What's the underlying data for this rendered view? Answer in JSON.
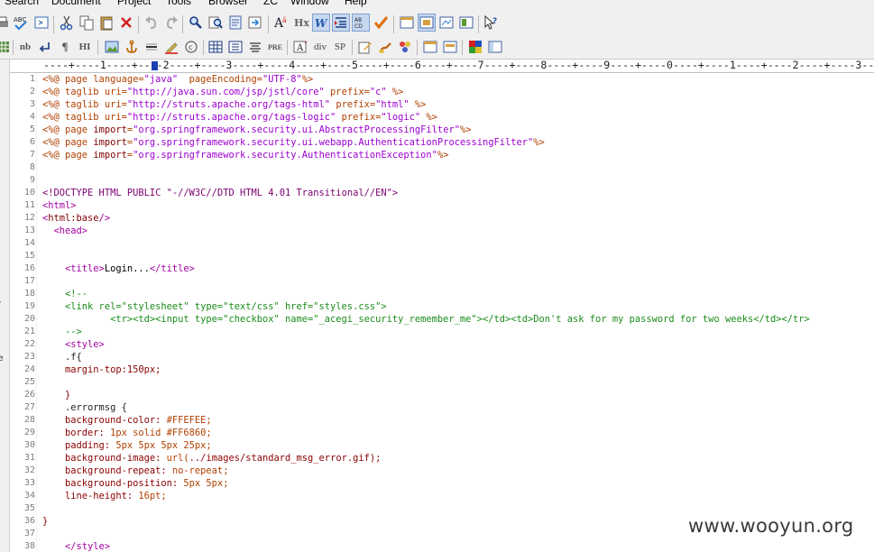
{
  "menu": [
    "Search",
    "Document",
    "Project",
    "Tools",
    "Browser",
    "ZC",
    "Window",
    "Help"
  ],
  "toolbar2": {
    "nb": "nb",
    "pilcrow": "¶",
    "hi": "HI",
    "pre": "PRE",
    "div": "div",
    "sp": "SP"
  },
  "ruler": "----+----1----+----2----+----3----+----4----+----5----+----6----+----7----+----8----+----9----+----0----+----1----+----2----+----3--",
  "line_numbers": [
    "1",
    "2",
    "3",
    "4",
    "5",
    "6",
    "7",
    "8",
    "9",
    "10",
    "11",
    "12",
    "13",
    "14",
    "15",
    "16",
    "17",
    "18",
    "19",
    "20",
    "21",
    "22",
    "23",
    "24",
    "25",
    "26",
    "27",
    "28",
    "29",
    "30",
    "31",
    "32",
    "33",
    "34",
    "35",
    "36",
    "37",
    "38"
  ],
  "code": {
    "l1": {
      "a": "<%@ page language=",
      "b": "\"java\"",
      "c": "  pageEncoding=",
      "d": "\"UTF-8\"",
      "e": "%>"
    },
    "l2": {
      "a": "<%@ taglib uri=",
      "b": "\"http://java.sun.com/jsp/jstl/core\"",
      "c": " prefix=",
      "d": "\"c\"",
      "e": " %>"
    },
    "l3": {
      "a": "<%@ taglib uri=",
      "b": "\"http://struts.apache.org/tags-html\"",
      "c": " prefix=",
      "d": "\"html\"",
      "e": " %>"
    },
    "l4": {
      "a": "<%@ taglib uri=",
      "b": "\"http://struts.apache.org/tags-logic\"",
      "c": " prefix=",
      "d": "\"logic\"",
      "e": " %>"
    },
    "l5": {
      "a": "<%@ page ",
      "b": "import",
      "c": "=",
      "d": "\"org.springframework.security.ui.AbstractProcessingFilter\"",
      "e": "%>"
    },
    "l6": {
      "a": "<%@ page ",
      "b": "import",
      "c": "=",
      "d": "\"org.springframework.security.ui.webapp.AuthenticationProcessingFilter\"",
      "e": "%>"
    },
    "l7": {
      "a": "<%@ page ",
      "b": "import",
      "c": "=",
      "d": "\"org.springframework.security.AuthenticationException\"",
      "e": "%>"
    },
    "l10": {
      "a": "<!DOCTYPE HTML PUBLIC ",
      "b": "\"-//W3C//DTD HTML 4.01 Transitional//EN\"",
      "c": ">"
    },
    "l11": "<html>",
    "l12": {
      "a": "<",
      "b": "html:base",
      "c": "/>"
    },
    "l13": "  <head>",
    "l16": {
      "a": "    <title>",
      "b": "Login...",
      "c": "</title>"
    },
    "l18": "    <!--",
    "l19": "    <link rel=\"stylesheet\" type=\"text/css\" href=\"styles.css\">",
    "l20": "            <tr><td><input type=\"checkbox\" name=\"_acegi_security_remember_me\"></td><td>Don't ask for my password for two weeks</td></tr>",
    "l21": "    -->",
    "l22": "    <style>",
    "l23": "    .f{",
    "l24": {
      "a": "    margin-top:",
      "b": "150px;"
    },
    "l26": "    }",
    "l27": "    .errormsg {",
    "l28": {
      "a": "    background-color: ",
      "b": "#FFEFEE;"
    },
    "l29": {
      "a": "    border: ",
      "b": "1px solid ",
      "c": "#FF6860;"
    },
    "l30": {
      "a": "    padding: ",
      "b": "5px 5px 5px 25px;"
    },
    "l31": {
      "a": "    background-image: ",
      "b": "url(",
      "c": "../images/standard_msg_error.gif);"
    },
    "l32": {
      "a": "    background-repeat: ",
      "b": "no-repeat;"
    },
    "l33": {
      "a": "    background-position: ",
      "b": "5px 5px;"
    },
    "l34": {
      "a": "    line-height: ",
      "b": "16pt;"
    },
    "l36": "}",
    "l38": "    </style>"
  },
  "left_strip": [
    "r",
    "e"
  ],
  "watermark": "www.wooyun.org",
  "icons_toolbar1": [
    "print-icon",
    "spellcheck-icon",
    "preview-icon",
    "cut-icon",
    "copy-icon",
    "paste-icon",
    "delete-icon",
    "undo-icon",
    "redo-icon",
    "find-icon",
    "replace-icon",
    "find-in-files-icon",
    "find-next-icon",
    "font-icon",
    "hx-icon",
    "wordwrap-icon",
    "indent-icon",
    "sort-icon",
    "check-icon",
    "view1-icon",
    "view2-icon",
    "view3-icon",
    "view4-icon",
    "help-icon"
  ],
  "icons_toolbar2": [
    "nb-icon",
    "linebreak-icon",
    "pilcrow-icon",
    "hi-icon",
    "image-icon",
    "anchor-icon",
    "hr-icon",
    "highlight-icon",
    "copyright-icon",
    "table-icon",
    "list-icon",
    "center-icon",
    "pre-icon",
    "html-tag-icon",
    "div-icon",
    "sp-icon",
    "edit-icon",
    "brush-icon",
    "palette-icon",
    "browser-icon",
    "color-icon",
    "window-icon"
  ]
}
